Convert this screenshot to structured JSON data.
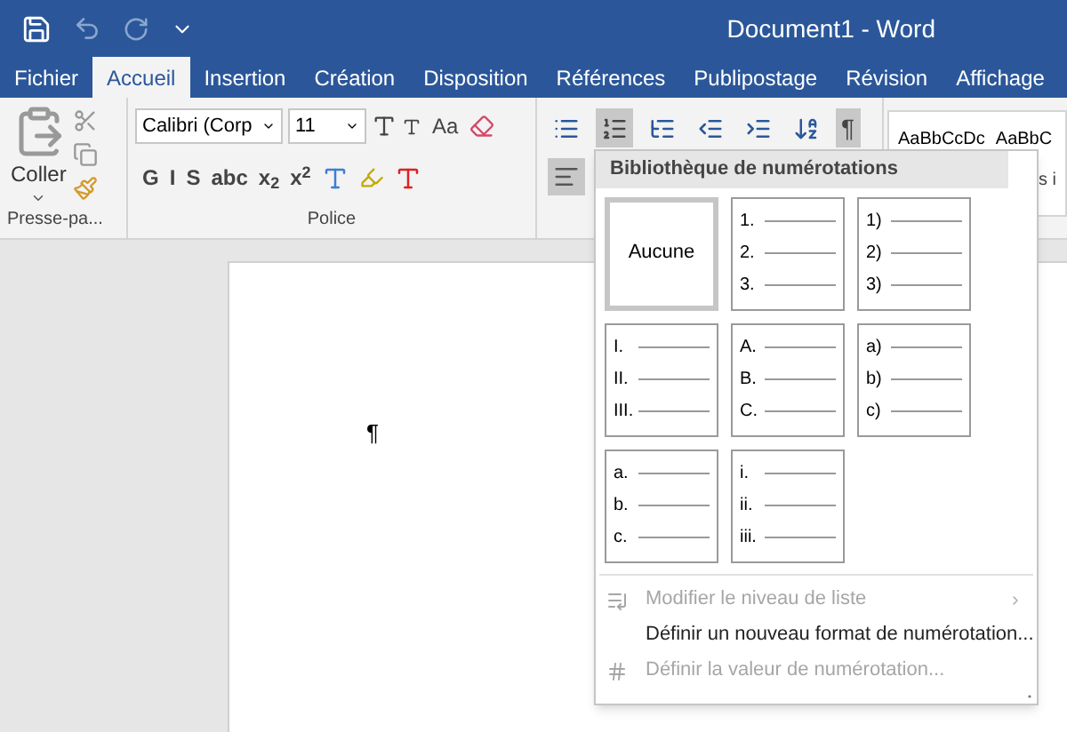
{
  "window": {
    "title": "Document1 - Word"
  },
  "tabs": [
    {
      "label": "Fichier",
      "selected": false
    },
    {
      "label": "Accueil",
      "selected": true
    },
    {
      "label": "Insertion",
      "selected": false
    },
    {
      "label": "Création",
      "selected": false
    },
    {
      "label": "Disposition",
      "selected": false
    },
    {
      "label": "Références",
      "selected": false
    },
    {
      "label": "Publipostage",
      "selected": false
    },
    {
      "label": "Révision",
      "selected": false
    },
    {
      "label": "Affichage",
      "selected": false
    }
  ],
  "clipboard": {
    "paste_label": "Coller",
    "group_label": "Presse-pa..."
  },
  "font": {
    "font_name": "Calibri (Corp",
    "font_size": "11",
    "case_label": "Aa",
    "format_buttons": [
      "G",
      "I",
      "S",
      "abc",
      "x$_{2}$",
      "x$^{2}$"
    ],
    "group_label": "Police"
  },
  "paragraph": {
    "buttons": [
      {
        "kind": "bullets",
        "selected": false
      },
      {
        "kind": "numbering",
        "selected": true
      },
      {
        "kind": "multilevel",
        "selected": false
      },
      {
        "kind": "outdent",
        "selected": false
      },
      {
        "kind": "indent",
        "selected": false
      },
      {
        "kind": "sort",
        "selected": false
      },
      {
        "kind": "pilcrow",
        "label": "¶",
        "selected": true
      }
    ],
    "align": [
      {
        "kind": "left",
        "selected": true
      }
    ]
  },
  "styles": [
    "AaBbCcDc",
    "AaBbC"
  ],
  "styles_caption": "s i",
  "document": {
    "paragraph_mark": "¶"
  },
  "numbering_menu": {
    "heading": "Bibliothèque de numérotations",
    "tiles": [
      {
        "kind": "none",
        "label": "Aucune",
        "selected": true
      },
      {
        "kind": "list",
        "markers": [
          "1.",
          "2.",
          "3."
        ],
        "selected": false
      },
      {
        "kind": "list",
        "markers": [
          "1)",
          "2)",
          "3)"
        ],
        "selected": false
      },
      {
        "kind": "list",
        "markers": [
          "I.",
          "II.",
          "III."
        ],
        "selected": false
      },
      {
        "kind": "list",
        "markers": [
          "A.",
          "B.",
          "C."
        ],
        "selected": false
      },
      {
        "kind": "list",
        "markers": [
          "a)",
          "b)",
          "c)"
        ],
        "selected": false
      },
      {
        "kind": "list",
        "markers": [
          "a.",
          "b.",
          "c."
        ],
        "selected": false
      },
      {
        "kind": "list",
        "markers": [
          "i.",
          "ii.",
          "iii."
        ],
        "selected": false
      }
    ],
    "items": [
      {
        "kind": "level",
        "label": "Modifier le niveau de liste",
        "disabled": true
      },
      {
        "kind": "define",
        "label": "Définir un nouveau format de numérotation...",
        "disabled": false
      },
      {
        "kind": "value",
        "label": "Définir la valeur de numérotation...",
        "disabled": true
      }
    ]
  }
}
